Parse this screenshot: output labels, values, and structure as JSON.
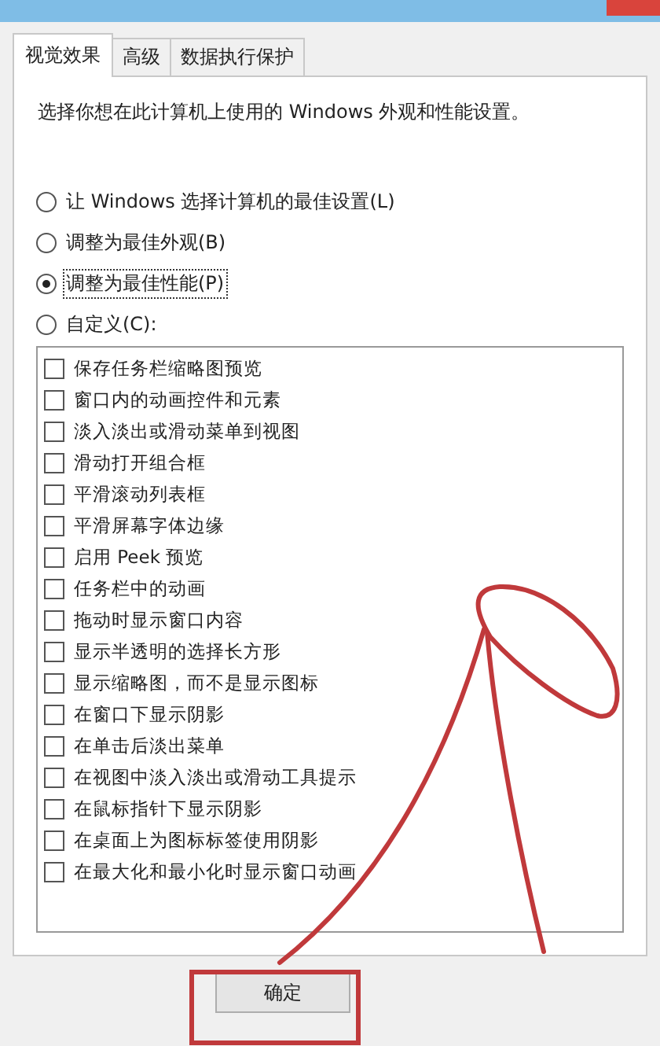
{
  "tabs": [
    {
      "label": "视觉效果",
      "selected": true
    },
    {
      "label": "高级",
      "selected": false
    },
    {
      "label": "数据执行保护",
      "selected": false
    }
  ],
  "description": "选择你想在此计算机上使用的 Windows 外观和性能设置。",
  "options": [
    {
      "label": "让 Windows 选择计算机的最佳设置(L)",
      "selected": false
    },
    {
      "label": "调整为最佳外观(B)",
      "selected": false
    },
    {
      "label": "调整为最佳性能(P)",
      "selected": true
    },
    {
      "label": "自定义(C):",
      "selected": false
    }
  ],
  "effects": [
    {
      "label": "保存任务栏缩略图预览",
      "checked": false
    },
    {
      "label": "窗口内的动画控件和元素",
      "checked": false
    },
    {
      "label": "淡入淡出或滑动菜单到视图",
      "checked": false
    },
    {
      "label": "滑动打开组合框",
      "checked": false
    },
    {
      "label": "平滑滚动列表框",
      "checked": false
    },
    {
      "label": "平滑屏幕字体边缘",
      "checked": false
    },
    {
      "label": "启用 Peek 预览",
      "checked": false
    },
    {
      "label": "任务栏中的动画",
      "checked": false
    },
    {
      "label": "拖动时显示窗口内容",
      "checked": false
    },
    {
      "label": "显示半透明的选择长方形",
      "checked": false
    },
    {
      "label": "显示缩略图，而不是显示图标",
      "checked": false
    },
    {
      "label": "在窗口下显示阴影",
      "checked": false
    },
    {
      "label": "在单击后淡出菜单",
      "checked": false
    },
    {
      "label": "在视图中淡入淡出或滑动工具提示",
      "checked": false
    },
    {
      "label": "在鼠标指针下显示阴影",
      "checked": false
    },
    {
      "label": "在桌面上为图标标签使用阴影",
      "checked": false
    },
    {
      "label": "在最大化和最小化时显示窗口动画",
      "checked": false
    }
  ],
  "buttons": [
    "确定"
  ]
}
